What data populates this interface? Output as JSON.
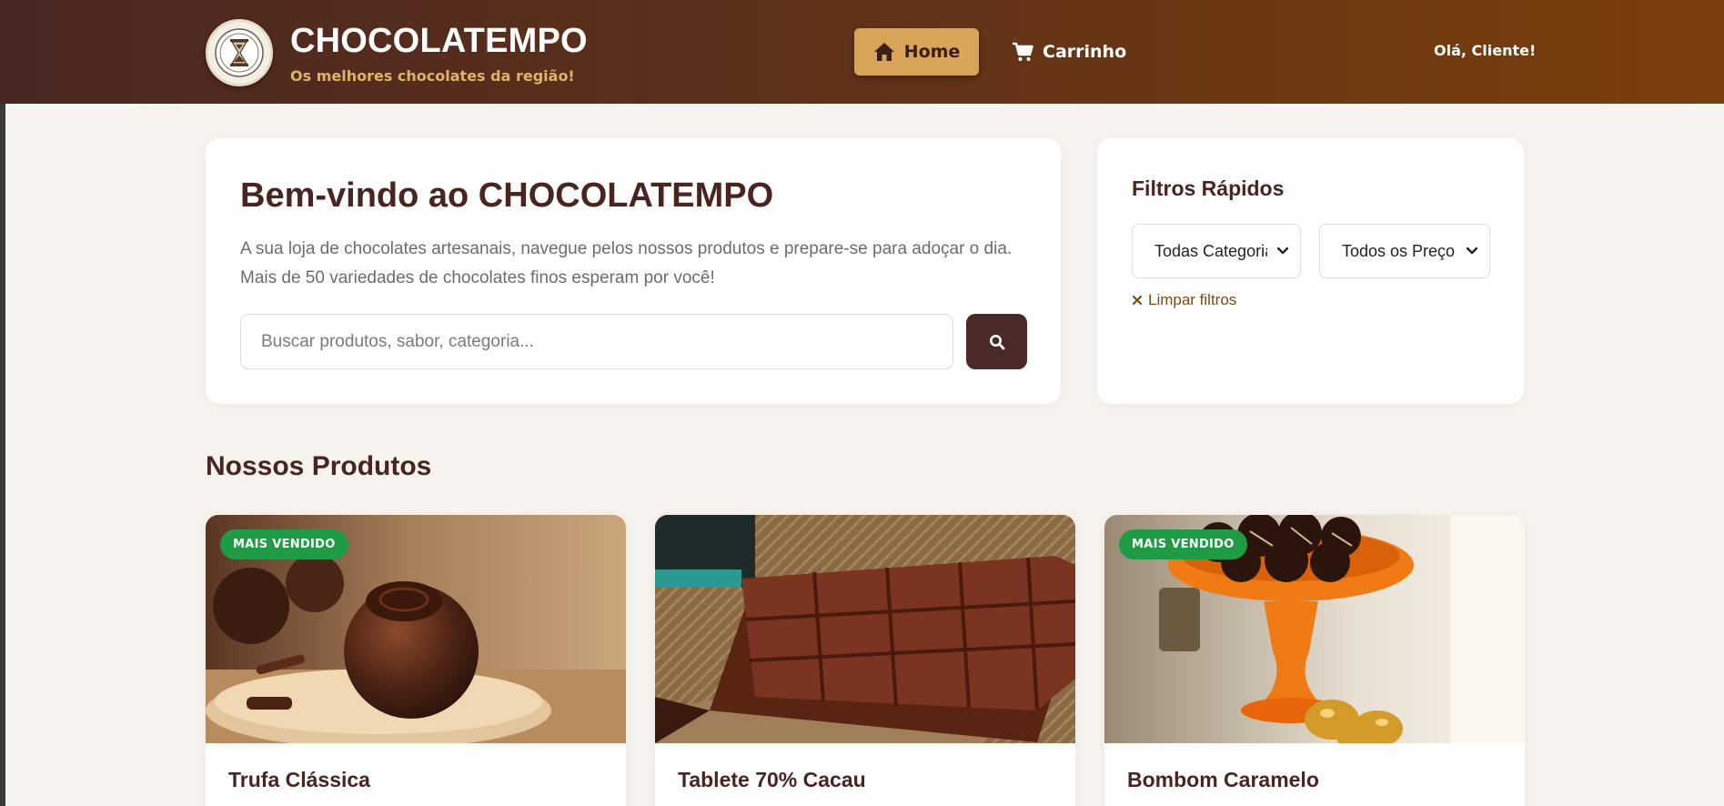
{
  "header": {
    "brand_name": "CHOCOLATEMPO",
    "tagline": "Os melhores chocolates da região!",
    "nav": {
      "home_label": "Home",
      "cart_label": "Carrinho"
    },
    "greeting": "Olá, Cliente!"
  },
  "hero": {
    "title": "Bem-vindo ao CHOCOLATEMPO",
    "description": "A sua loja de chocolates artesanais, navegue pelos nossos produtos e prepare-se para adoçar o dia. Mais de 50 variedades de chocolates finos esperam por você!",
    "search_placeholder": "Buscar produtos, sabor, categoria...",
    "search_value": ""
  },
  "filters": {
    "title": "Filtros Rápidos",
    "category_selected": "Todas Categorias",
    "price_selected": "Todos os Preços",
    "clear_label": "Limpar filtros"
  },
  "products_section": {
    "title": "Nossos Produtos",
    "items": [
      {
        "name": "Trufa Clássica",
        "badge": "MAIS VENDIDO"
      },
      {
        "name": "Tablete 70% Cacau",
        "badge": ""
      },
      {
        "name": "Bombom Caramelo",
        "badge": "MAIS VENDIDO"
      }
    ]
  },
  "colors": {
    "header_start": "#4a2722",
    "header_end": "#7a3f0c",
    "accent_gold": "#d8a45a",
    "brand_brown": "#4a2520",
    "badge_green": "#1f9a45",
    "background": "#f7f4f0"
  },
  "icons": {
    "home": "home-icon",
    "cart": "cart-icon",
    "search": "search-icon",
    "close": "close-icon",
    "chevron": "chevron-down-icon",
    "logo": "hourglass-logo"
  }
}
